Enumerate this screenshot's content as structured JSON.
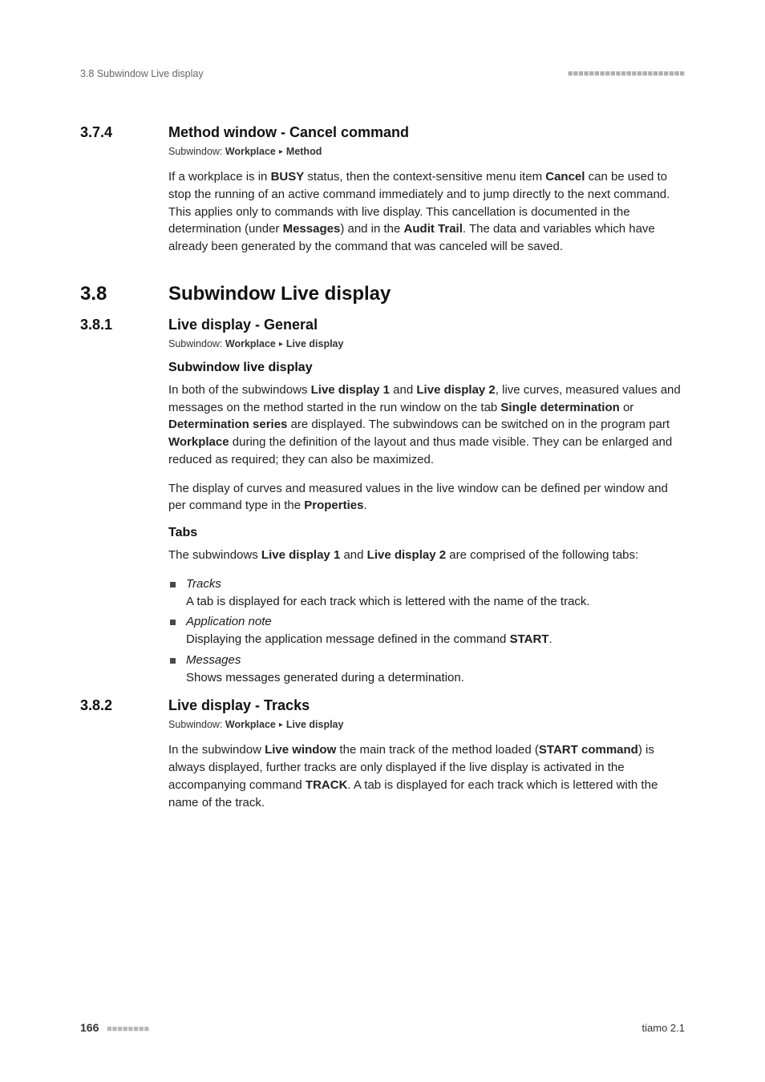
{
  "header": {
    "left": "3.8 Subwindow Live display",
    "right_ticks": "■■■■■■■■■■■■■■■■■■■■■■"
  },
  "sec_374": {
    "num": "3.7.4",
    "title": "Method window - Cancel command",
    "subwin_label": "Subwindow: ",
    "subwin_path1": "Workplace",
    "subwin_sep": "▸",
    "subwin_path2": "Method",
    "para1_a": "If a workplace is in ",
    "para1_busy": "BUSY",
    "para1_b": " status, then the context-sensitive menu item ",
    "para1_cancel": "Cancel",
    "para1_c": " can be used to stop the running of an active command immediately and to jump directly to the next command. This applies only to commands with live display. This cancellation is documented in the determination (under ",
    "para1_messages": "Messages",
    "para1_d": ") and in the ",
    "para1_audit": "Audit Trail",
    "para1_e": ". The data and variables which have already been generated by the command that was canceled will be saved."
  },
  "sec_38": {
    "num": "3.8",
    "title": "Subwindow Live display"
  },
  "sec_381": {
    "num": "3.8.1",
    "title": "Live display - General",
    "subwin_label": "Subwindow: ",
    "subwin_path1": "Workplace",
    "subwin_sep": "▸",
    "subwin_path2": "Live display",
    "h_subwindow": "Subwindow live display",
    "p1_a": "In both of the subwindows ",
    "p1_ld1": "Live display 1",
    "p1_b": " and ",
    "p1_ld2": "Live display 2",
    "p1_c": ", live curves, measured values and messages on the method started in the run window on the tab ",
    "p1_sd": "Single determination",
    "p1_d": " or ",
    "p1_ds": "Determination series",
    "p1_e": " are displayed. The subwindows can be switched on in the program part ",
    "p1_wp": "Workplace",
    "p1_f": " during the definition of the layout and thus made visible. They can be enlarged and reduced as required; they can also be maximized.",
    "p2_a": "The display of curves and measured values in the live window can be defined per window and per command type in the ",
    "p2_props": "Properties",
    "p2_b": ".",
    "h_tabs": "Tabs",
    "p3_a": "The subwindows ",
    "p3_ld1": "Live display 1",
    "p3_b": " and ",
    "p3_ld2": "Live display 2",
    "p3_c": " are comprised of the following tabs:",
    "li1_head": "Tracks",
    "li1_body": "A tab is displayed for each track which is lettered with the name of the track.",
    "li2_head": "Application note",
    "li2_body_a": "Displaying the application message defined in the command ",
    "li2_body_start": "START",
    "li2_body_b": ".",
    "li3_head": "Messages",
    "li3_body": "Shows messages generated during a determination."
  },
  "sec_382": {
    "num": "3.8.2",
    "title": "Live display - Tracks",
    "subwin_label": "Subwindow: ",
    "subwin_path1": "Workplace",
    "subwin_sep": "▸",
    "subwin_path2": "Live display",
    "p1_a": "In the subwindow ",
    "p1_lw": "Live window",
    "p1_b": " the main track of the method loaded (",
    "p1_sc": "START command",
    "p1_c": ") is always displayed, further tracks are only displayed if the live display is activated in the accompanying command ",
    "p1_track": "TRACK",
    "p1_d": ". A tab is displayed for each track which is lettered with the name of the track."
  },
  "footer": {
    "page": "166",
    "ticks": "■■■■■■■■",
    "right": "tiamo 2.1"
  }
}
